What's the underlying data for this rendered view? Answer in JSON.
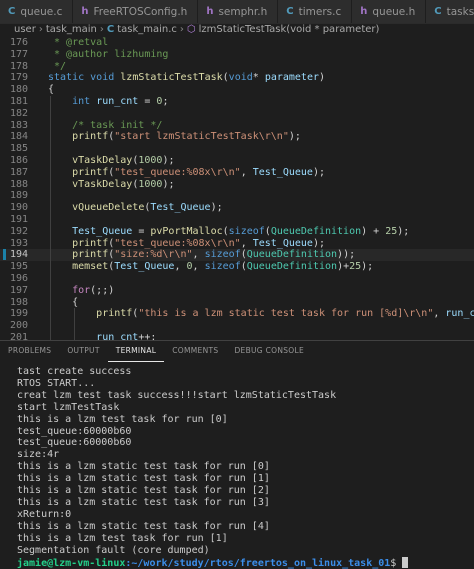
{
  "tabs": [
    {
      "icon": "C",
      "label": "queue.c"
    },
    {
      "icon": "h",
      "label": "FreeRTOSConfig.h"
    },
    {
      "icon": "h",
      "label": "semphr.h"
    },
    {
      "icon": "C",
      "label": "timers.c"
    },
    {
      "icon": "h",
      "label": "queue.h"
    },
    {
      "icon": "C",
      "label": "tasks.c"
    }
  ],
  "breadcrumb": {
    "user": "user",
    "folder": "task_main",
    "file_icon": "C",
    "file": "task_main.c",
    "symbol": "lzmStaticTestTask(void * parameter)"
  },
  "editor": {
    "current_line": 194,
    "lines": [
      {
        "n": "176",
        "t": " * @retval"
      },
      {
        "n": "177",
        "t": " * @author lizhuming"
      },
      {
        "n": "178",
        "t": " */"
      },
      {
        "n": "179",
        "t": "static void lzmStaticTestTask(void* parameter)"
      },
      {
        "n": "180",
        "t": "{"
      },
      {
        "n": "181",
        "t": "    int run_cnt = 0;"
      },
      {
        "n": "182",
        "t": ""
      },
      {
        "n": "183",
        "t": "    /* task init */"
      },
      {
        "n": "184",
        "t": "    printf(\"start lzmStaticTestTask\\r\\n\");"
      },
      {
        "n": "185",
        "t": ""
      },
      {
        "n": "186",
        "t": "    vTaskDelay(1000);"
      },
      {
        "n": "187",
        "t": "    printf(\"test_queue:%08x\\r\\n\", Test_Queue);"
      },
      {
        "n": "188",
        "t": "    vTaskDelay(1000);"
      },
      {
        "n": "189",
        "t": ""
      },
      {
        "n": "190",
        "t": "    vQueueDelete(Test_Queue);"
      },
      {
        "n": "191",
        "t": ""
      },
      {
        "n": "192",
        "t": "    Test_Queue = pvPortMalloc(sizeof(QueueDefinition) + 25);"
      },
      {
        "n": "193",
        "t": "    printf(\"test_queue:%08x\\r\\n\", Test_Queue);"
      },
      {
        "n": "194",
        "t": "    printf(\"size:%d\\r\\n\", sizeof(QueueDefinition));"
      },
      {
        "n": "195",
        "t": "    memset(Test_Queue, 0, sizeof(QueueDefinition)+25);"
      },
      {
        "n": "196",
        "t": ""
      },
      {
        "n": "197",
        "t": "    for(;;)"
      },
      {
        "n": "198",
        "t": "    {"
      },
      {
        "n": "199",
        "t": "        printf(\"this is a lzm static test task for run [%d]\\r\\n\", run_cnt);"
      },
      {
        "n": "200",
        "t": ""
      },
      {
        "n": "201",
        "t": "        run_cnt++;"
      }
    ]
  },
  "panel": {
    "tabs": [
      "PROBLEMS",
      "OUTPUT",
      "TERMINAL",
      "COMMENTS",
      "DEBUG CONSOLE"
    ],
    "active_tab": "TERMINAL",
    "terminal_lines": [
      "tast create success",
      "RTOS START...",
      "creat lzm test task success!!!start lzmStaticTestTask",
      "start lzmTestTask",
      "this is a lzm test task for run [0]",
      "test_queue:60000b60",
      "test_queue:60000b60",
      "size:4r",
      "this is a lzm static test task for run [0]",
      "this is a lzm static test task for run [1]",
      "this is a lzm static test task for run [2]",
      "this is a lzm static test task for run [3]",
      "xReturn:0",
      "this is a lzm static test task for run [4]",
      "this is a lzm test task for run [1]",
      "Segmentation fault (core dumped)"
    ],
    "prompt_user": "jamie@lzm-vm-linux",
    "prompt_path": ":~/work/study/rtos/freertos_on_linux_task_01",
    "prompt_symbol": "$ "
  }
}
